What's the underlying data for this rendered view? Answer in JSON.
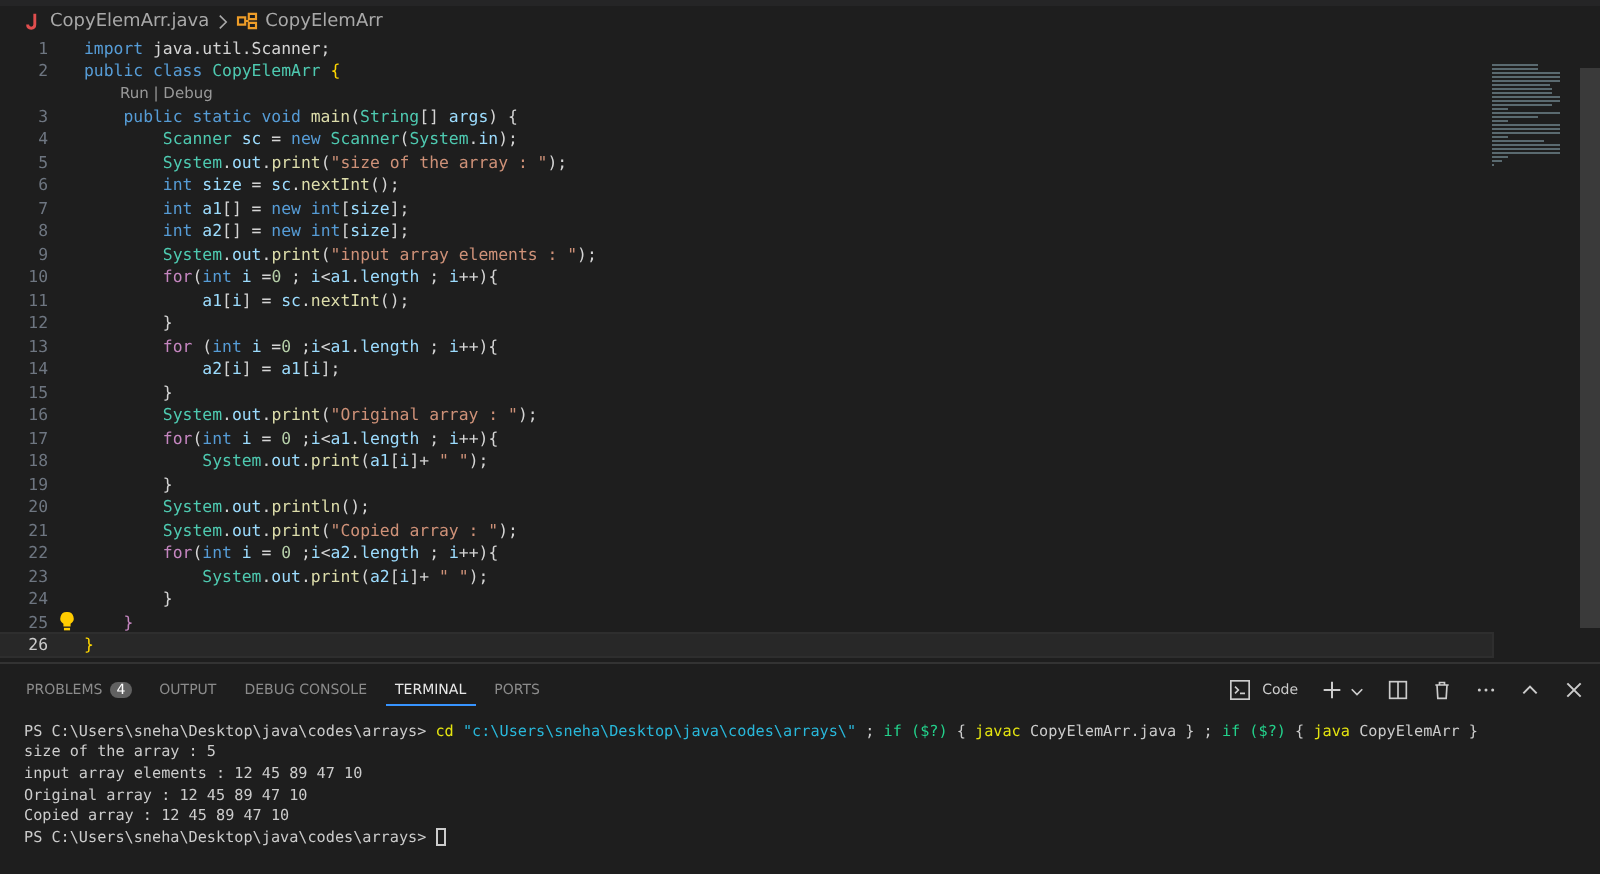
{
  "breadcrumb": {
    "file": "CopyElemArr.java",
    "symbol": "CopyElemArr"
  },
  "editor": {
    "lines": [
      {
        "number": "1",
        "current": false,
        "lightbulb": false,
        "tokens": [
          {
            "kind": "kw",
            "text": "import"
          },
          {
            "kind": "plain",
            "text": " java.util.Scanner;"
          }
        ]
      },
      {
        "number": "2",
        "current": false,
        "lightbulb": false,
        "codelens": "Run | Debug",
        "tokens": [
          {
            "kind": "kw",
            "text": "public class "
          },
          {
            "kind": "type",
            "text": "CopyElemArr "
          },
          {
            "kind": "brace",
            "text": "{"
          }
        ]
      },
      {
        "number": "3",
        "current": false,
        "lightbulb": false,
        "tokens": [
          {
            "kind": "kw",
            "text": "    public static void "
          },
          {
            "kind": "fn",
            "text": "main"
          },
          {
            "kind": "plain",
            "text": "("
          },
          {
            "kind": "type",
            "text": "String"
          },
          {
            "kind": "plain",
            "text": "[] "
          },
          {
            "kind": "var",
            "text": "args"
          },
          {
            "kind": "plain",
            "text": ") {"
          }
        ]
      },
      {
        "number": "4",
        "current": false,
        "lightbulb": false,
        "tokens": [
          {
            "kind": "type",
            "text": "        Scanner"
          },
          {
            "kind": "var",
            "text": " sc"
          },
          {
            "kind": "plain",
            "text": " = "
          },
          {
            "kind": "kw",
            "text": "new "
          },
          {
            "kind": "type",
            "text": "Scanner"
          },
          {
            "kind": "plain",
            "text": "("
          },
          {
            "kind": "type",
            "text": "System"
          },
          {
            "kind": "plain",
            "text": "."
          },
          {
            "kind": "var",
            "text": "in"
          },
          {
            "kind": "plain",
            "text": ");"
          }
        ]
      },
      {
        "number": "5",
        "current": false,
        "lightbulb": false,
        "tokens": [
          {
            "kind": "type",
            "text": "        System"
          },
          {
            "kind": "plain",
            "text": "."
          },
          {
            "kind": "var",
            "text": "out"
          },
          {
            "kind": "plain",
            "text": "."
          },
          {
            "kind": "fn",
            "text": "print"
          },
          {
            "kind": "plain",
            "text": "("
          },
          {
            "kind": "str",
            "text": "\"size of the array : \""
          },
          {
            "kind": "plain",
            "text": ");"
          }
        ]
      },
      {
        "number": "6",
        "current": false,
        "lightbulb": false,
        "tokens": [
          {
            "kind": "kw",
            "text": "        int "
          },
          {
            "kind": "var",
            "text": "size"
          },
          {
            "kind": "plain",
            "text": " = "
          },
          {
            "kind": "var",
            "text": "sc"
          },
          {
            "kind": "plain",
            "text": "."
          },
          {
            "kind": "fn",
            "text": "nextInt"
          },
          {
            "kind": "plain",
            "text": "();"
          }
        ]
      },
      {
        "number": "7",
        "current": false,
        "lightbulb": false,
        "tokens": [
          {
            "kind": "kw",
            "text": "        int "
          },
          {
            "kind": "var",
            "text": "a1"
          },
          {
            "kind": "plain",
            "text": "[] = "
          },
          {
            "kind": "kw",
            "text": "new int"
          },
          {
            "kind": "plain",
            "text": "["
          },
          {
            "kind": "var",
            "text": "size"
          },
          {
            "kind": "plain",
            "text": "];"
          }
        ]
      },
      {
        "number": "8",
        "current": false,
        "lightbulb": false,
        "tokens": [
          {
            "kind": "kw",
            "text": "        int "
          },
          {
            "kind": "var",
            "text": "a2"
          },
          {
            "kind": "plain",
            "text": "[] = "
          },
          {
            "kind": "kw",
            "text": "new int"
          },
          {
            "kind": "plain",
            "text": "["
          },
          {
            "kind": "var",
            "text": "size"
          },
          {
            "kind": "plain",
            "text": "];"
          }
        ]
      },
      {
        "number": "9",
        "current": false,
        "lightbulb": false,
        "tokens": [
          {
            "kind": "type",
            "text": "        System"
          },
          {
            "kind": "plain",
            "text": "."
          },
          {
            "kind": "var",
            "text": "out"
          },
          {
            "kind": "plain",
            "text": "."
          },
          {
            "kind": "fn",
            "text": "print"
          },
          {
            "kind": "plain",
            "text": "("
          },
          {
            "kind": "str",
            "text": "\"input array elements : \""
          },
          {
            "kind": "plain",
            "text": ");"
          }
        ]
      },
      {
        "number": "10",
        "current": false,
        "lightbulb": false,
        "tokens": [
          {
            "kind": "ctrl",
            "text": "        for"
          },
          {
            "kind": "plain",
            "text": "("
          },
          {
            "kind": "kw",
            "text": "int "
          },
          {
            "kind": "var",
            "text": "i"
          },
          {
            "kind": "plain",
            "text": " ="
          },
          {
            "kind": "num",
            "text": "0"
          },
          {
            "kind": "plain",
            "text": " ; "
          },
          {
            "kind": "var",
            "text": "i"
          },
          {
            "kind": "plain",
            "text": "<"
          },
          {
            "kind": "var",
            "text": "a1"
          },
          {
            "kind": "plain",
            "text": "."
          },
          {
            "kind": "var",
            "text": "length"
          },
          {
            "kind": "plain",
            "text": " ; "
          },
          {
            "kind": "var",
            "text": "i"
          },
          {
            "kind": "plain",
            "text": "++){"
          }
        ]
      },
      {
        "number": "11",
        "current": false,
        "lightbulb": false,
        "tokens": [
          {
            "kind": "var",
            "text": "            a1"
          },
          {
            "kind": "plain",
            "text": "["
          },
          {
            "kind": "var",
            "text": "i"
          },
          {
            "kind": "plain",
            "text": "] = "
          },
          {
            "kind": "var",
            "text": "sc"
          },
          {
            "kind": "plain",
            "text": "."
          },
          {
            "kind": "fn",
            "text": "nextInt"
          },
          {
            "kind": "plain",
            "text": "();"
          }
        ]
      },
      {
        "number": "12",
        "current": false,
        "lightbulb": false,
        "tokens": [
          {
            "kind": "plain",
            "text": "        }"
          }
        ]
      },
      {
        "number": "13",
        "current": false,
        "lightbulb": false,
        "tokens": [
          {
            "kind": "ctrl",
            "text": "        for"
          },
          {
            "kind": "plain",
            "text": " ("
          },
          {
            "kind": "kw",
            "text": "int "
          },
          {
            "kind": "var",
            "text": "i"
          },
          {
            "kind": "plain",
            "text": " ="
          },
          {
            "kind": "num",
            "text": "0"
          },
          {
            "kind": "plain",
            "text": " ;"
          },
          {
            "kind": "var",
            "text": "i"
          },
          {
            "kind": "plain",
            "text": "<"
          },
          {
            "kind": "var",
            "text": "a1"
          },
          {
            "kind": "plain",
            "text": "."
          },
          {
            "kind": "var",
            "text": "length"
          },
          {
            "kind": "plain",
            "text": " ; "
          },
          {
            "kind": "var",
            "text": "i"
          },
          {
            "kind": "plain",
            "text": "++){"
          }
        ]
      },
      {
        "number": "14",
        "current": false,
        "lightbulb": false,
        "tokens": [
          {
            "kind": "var",
            "text": "            a2"
          },
          {
            "kind": "plain",
            "text": "["
          },
          {
            "kind": "var",
            "text": "i"
          },
          {
            "kind": "plain",
            "text": "] = "
          },
          {
            "kind": "var",
            "text": "a1"
          },
          {
            "kind": "plain",
            "text": "["
          },
          {
            "kind": "var",
            "text": "i"
          },
          {
            "kind": "plain",
            "text": "];"
          }
        ]
      },
      {
        "number": "15",
        "current": false,
        "lightbulb": false,
        "tokens": [
          {
            "kind": "plain",
            "text": "        }"
          }
        ]
      },
      {
        "number": "16",
        "current": false,
        "lightbulb": false,
        "tokens": [
          {
            "kind": "type",
            "text": "        System"
          },
          {
            "kind": "plain",
            "text": "."
          },
          {
            "kind": "var",
            "text": "out"
          },
          {
            "kind": "plain",
            "text": "."
          },
          {
            "kind": "fn",
            "text": "print"
          },
          {
            "kind": "plain",
            "text": "("
          },
          {
            "kind": "str",
            "text": "\"Original array : \""
          },
          {
            "kind": "plain",
            "text": ");"
          }
        ]
      },
      {
        "number": "17",
        "current": false,
        "lightbulb": false,
        "tokens": [
          {
            "kind": "ctrl",
            "text": "        for"
          },
          {
            "kind": "plain",
            "text": "("
          },
          {
            "kind": "kw",
            "text": "int "
          },
          {
            "kind": "var",
            "text": "i"
          },
          {
            "kind": "plain",
            "text": " = "
          },
          {
            "kind": "num",
            "text": "0"
          },
          {
            "kind": "plain",
            "text": " ;"
          },
          {
            "kind": "var",
            "text": "i"
          },
          {
            "kind": "plain",
            "text": "<"
          },
          {
            "kind": "var",
            "text": "a1"
          },
          {
            "kind": "plain",
            "text": "."
          },
          {
            "kind": "var",
            "text": "length"
          },
          {
            "kind": "plain",
            "text": " ; "
          },
          {
            "kind": "var",
            "text": "i"
          },
          {
            "kind": "plain",
            "text": "++){"
          }
        ]
      },
      {
        "number": "18",
        "current": false,
        "lightbulb": false,
        "tokens": [
          {
            "kind": "type",
            "text": "            System"
          },
          {
            "kind": "plain",
            "text": "."
          },
          {
            "kind": "var",
            "text": "out"
          },
          {
            "kind": "plain",
            "text": "."
          },
          {
            "kind": "fn",
            "text": "print"
          },
          {
            "kind": "plain",
            "text": "("
          },
          {
            "kind": "var",
            "text": "a1"
          },
          {
            "kind": "plain",
            "text": "["
          },
          {
            "kind": "var",
            "text": "i"
          },
          {
            "kind": "plain",
            "text": "]+ "
          },
          {
            "kind": "str",
            "text": "\" \""
          },
          {
            "kind": "plain",
            "text": ");"
          }
        ]
      },
      {
        "number": "19",
        "current": false,
        "lightbulb": false,
        "tokens": [
          {
            "kind": "plain",
            "text": "        }"
          }
        ]
      },
      {
        "number": "20",
        "current": false,
        "lightbulb": false,
        "tokens": [
          {
            "kind": "type",
            "text": "        System"
          },
          {
            "kind": "plain",
            "text": "."
          },
          {
            "kind": "var",
            "text": "out"
          },
          {
            "kind": "plain",
            "text": "."
          },
          {
            "kind": "fn",
            "text": "println"
          },
          {
            "kind": "plain",
            "text": "();"
          }
        ]
      },
      {
        "number": "21",
        "current": false,
        "lightbulb": false,
        "tokens": [
          {
            "kind": "type",
            "text": "        System"
          },
          {
            "kind": "plain",
            "text": "."
          },
          {
            "kind": "var",
            "text": "out"
          },
          {
            "kind": "plain",
            "text": "."
          },
          {
            "kind": "fn",
            "text": "print"
          },
          {
            "kind": "plain",
            "text": "("
          },
          {
            "kind": "str",
            "text": "\"Copied array : \""
          },
          {
            "kind": "plain",
            "text": ");"
          }
        ]
      },
      {
        "number": "22",
        "current": false,
        "lightbulb": false,
        "tokens": [
          {
            "kind": "ctrl",
            "text": "        for"
          },
          {
            "kind": "plain",
            "text": "("
          },
          {
            "kind": "kw",
            "text": "int "
          },
          {
            "kind": "var",
            "text": "i"
          },
          {
            "kind": "plain",
            "text": " = "
          },
          {
            "kind": "num",
            "text": "0"
          },
          {
            "kind": "plain",
            "text": " ;"
          },
          {
            "kind": "var",
            "text": "i"
          },
          {
            "kind": "plain",
            "text": "<"
          },
          {
            "kind": "var",
            "text": "a2"
          },
          {
            "kind": "plain",
            "text": "."
          },
          {
            "kind": "var",
            "text": "length"
          },
          {
            "kind": "plain",
            "text": " ; "
          },
          {
            "kind": "var",
            "text": "i"
          },
          {
            "kind": "plain",
            "text": "++){"
          }
        ]
      },
      {
        "number": "23",
        "current": false,
        "lightbulb": false,
        "tokens": [
          {
            "kind": "type",
            "text": "            System"
          },
          {
            "kind": "plain",
            "text": "."
          },
          {
            "kind": "var",
            "text": "out"
          },
          {
            "kind": "plain",
            "text": "."
          },
          {
            "kind": "fn",
            "text": "print"
          },
          {
            "kind": "plain",
            "text": "("
          },
          {
            "kind": "var",
            "text": "a2"
          },
          {
            "kind": "plain",
            "text": "["
          },
          {
            "kind": "var",
            "text": "i"
          },
          {
            "kind": "plain",
            "text": "]+ "
          },
          {
            "kind": "str",
            "text": "\" \""
          },
          {
            "kind": "plain",
            "text": ");"
          }
        ]
      },
      {
        "number": "24",
        "current": false,
        "lightbulb": false,
        "tokens": [
          {
            "kind": "plain",
            "text": "        }"
          }
        ]
      },
      {
        "number": "25",
        "current": false,
        "lightbulb": true,
        "tokens": [
          {
            "kind": "ctrl",
            "text": "    }"
          }
        ]
      },
      {
        "number": "26",
        "current": true,
        "lightbulb": false,
        "tokens": [
          {
            "kind": "brace",
            "text": "}"
          }
        ]
      }
    ]
  },
  "panel": {
    "tabs": [
      {
        "label": "PROBLEMS",
        "badge": "4",
        "selected": false
      },
      {
        "label": "OUTPUT",
        "selected": false
      },
      {
        "label": "DEBUG CONSOLE",
        "selected": false
      },
      {
        "label": "TERMINAL",
        "selected": true
      },
      {
        "label": "PORTS",
        "selected": false
      }
    ],
    "terminal_name": "Code",
    "terminal": [
      {
        "tokens": [
          {
            "kind": "plain",
            "text": "PS C:\\Users\\sneha\\Desktop\\java\\codes\\arrays> "
          },
          {
            "kind": "cmd",
            "text": "cd"
          },
          {
            "kind": "str",
            "text": " \"c:\\Users\\sneha\\Desktop\\java\\codes\\arrays\\\""
          },
          {
            "kind": "plain",
            "text": " ; "
          },
          {
            "kind": "kw",
            "text": "if ($?)"
          },
          {
            "kind": "plain",
            "text": " { "
          },
          {
            "kind": "cmd",
            "text": "javac"
          },
          {
            "kind": "plain",
            "text": " CopyElemArr.java } ; "
          },
          {
            "kind": "kw",
            "text": "if ($?)"
          },
          {
            "kind": "plain",
            "text": " { "
          },
          {
            "kind": "cmd",
            "text": "java"
          },
          {
            "kind": "plain",
            "text": " CopyElemArr }"
          }
        ]
      },
      {
        "tokens": [
          {
            "kind": "plain",
            "text": "size of the array : 5"
          }
        ]
      },
      {
        "tokens": [
          {
            "kind": "plain",
            "text": "input array elements : 12 45 89 47 10"
          }
        ]
      },
      {
        "tokens": [
          {
            "kind": "plain",
            "text": "Original array : 12 45 89 47 10"
          }
        ]
      },
      {
        "tokens": [
          {
            "kind": "plain",
            "text": "Copied array : 12 45 89 47 10"
          }
        ]
      },
      {
        "cursor": true,
        "tokens": [
          {
            "kind": "plain",
            "text": "PS C:\\Users\\sneha\\Desktop\\java\\codes\\arrays> "
          }
        ]
      }
    ]
  }
}
